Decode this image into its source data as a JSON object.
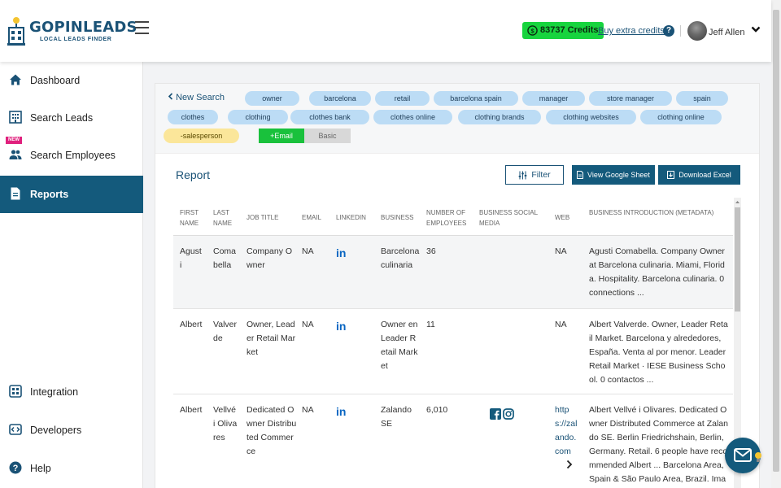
{
  "brand": {
    "name": "GOPINLEADS",
    "tagline": "LOCAL LEADS FINDER"
  },
  "header": {
    "credits": "83737 Credits",
    "buy_credits": "Buy extra credits",
    "help": "?",
    "user_name": "Jeff Allen"
  },
  "sidebar": {
    "items": [
      {
        "label": "Dashboard",
        "icon": "home-icon"
      },
      {
        "label": "Search Leads",
        "icon": "building-icon"
      },
      {
        "label": "Search Employees",
        "icon": "people-icon",
        "badge": "NEW"
      },
      {
        "label": "Reports",
        "icon": "document-icon",
        "active": true
      }
    ],
    "bottom_items": [
      {
        "label": "Integration",
        "icon": "integration-icon"
      },
      {
        "label": "Developers",
        "icon": "code-icon"
      },
      {
        "label": "Help",
        "icon": "help-icon"
      }
    ]
  },
  "search": {
    "new_search": "New Search",
    "tags": [
      "owner",
      "barcelona",
      "retail",
      "barcelona spain",
      "manager",
      "store manager",
      "spain",
      "clothes",
      "clothing",
      "clothes bank",
      "clothes online",
      "clothing brands",
      "clothing websites",
      "clothing online",
      "-salesperson"
    ],
    "mode_active": "+Email",
    "mode_inactive": "Basic"
  },
  "report": {
    "title": "Report",
    "filter_label": "Filter",
    "google_sheet_label": "View Google Sheet",
    "excel_label": "Download Excel",
    "columns": [
      "FIRST NAME",
      "LAST NAME",
      "JOB TITLE",
      "EMAIL",
      "LINKEDIN",
      "BUSINESS",
      "NUMBER OF EMPLOYEES",
      "BUSINESS SOCIAL MEDIA",
      "WEB",
      "BUSINESS INTRODUCTION (METADATA)"
    ],
    "rows": [
      {
        "first": "Agusti",
        "last": "Comabella",
        "job": "Company Owner",
        "email": "NA",
        "linkedin": "in",
        "business": "Barcelona culinaria",
        "employees": "36",
        "web": "NA",
        "intro": "Agusti Comabella. Company Owner at Barcelona culinaria. Miami, Florida. Hospitality. Barcelona culinaria. 0 connections ..."
      },
      {
        "first": "Albert",
        "last": "Valverde",
        "job": "Owner, Leader Retail Market",
        "email": "NA",
        "linkedin": "in",
        "business": "Owner en Leader Retail Market",
        "employees": "11",
        "web": "NA",
        "intro": "Albert Valverde. Owner, Leader Retail Market. Barcelona y alrededores, España. Venta al por menor. Leader Retail Market · IESE Business School. 0 contactos ..."
      },
      {
        "first": "Albert",
        "last": "Vellvé i Olivares",
        "job": "Dedicated Owner Distributed Commerce",
        "email": "NA",
        "linkedin": "in",
        "business": "Zalando SE",
        "employees": "6,010",
        "web": "https://zalando.com",
        "intro": "Albert Vellvé i Olivares. Dedicated Owner Distributed Commerce at Zalando SE. Berlin Friedrichshain, Berlin, Germany. Retail. 6 people have recommended Albert ... Barcelona Area, Spain & São Paulo Area, Brazil. Imag"
      }
    ]
  },
  "colors": {
    "primary": "#145a7c",
    "credits_green": "#17d43e",
    "tag_blue": "#bcdcf5",
    "tag_yellow": "#fbe69a",
    "linkedin": "#0a66c2"
  }
}
